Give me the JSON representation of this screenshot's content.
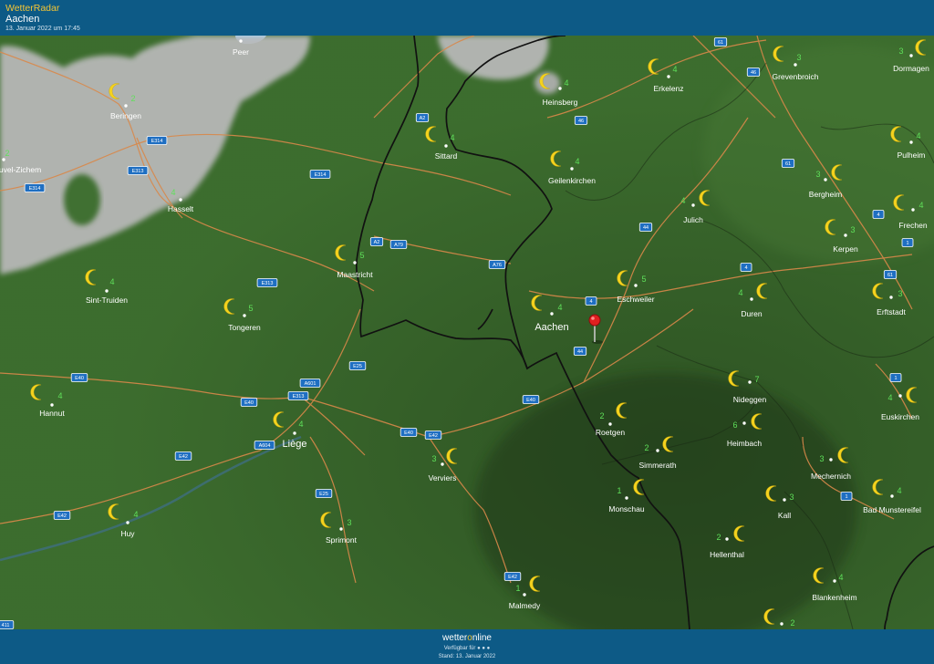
{
  "header": {
    "app_title": "WetterRadar",
    "location": "Aachen",
    "timestamp": "13. Januar 2022 um 17:45"
  },
  "footer": {
    "brand_prefix": "wetter",
    "brand_o": "o",
    "brand_suffix": "nline",
    "available_for": "Verfügbar für",
    "stand": "Stand: 13. Januar 2022"
  },
  "colors": {
    "header_bg": "#0d5a86",
    "app_title": "#f4c534",
    "temperature": "#5fe05a",
    "moon": "#f4d21e",
    "road": "#d9884a",
    "border": "#111111",
    "clouds": "#b9b9b9"
  },
  "map": {
    "pin_icon": "map-pin-icon",
    "weather_icon": "moon-icon",
    "cities": [
      {
        "name": "Peer",
        "temp": ""
      },
      {
        "name": "Beringen",
        "temp": "2"
      },
      {
        "name": "uvel-Zichem",
        "temp": "2"
      },
      {
        "name": "Hasselt",
        "temp": "4"
      },
      {
        "name": "Sint-Truiden",
        "temp": "4"
      },
      {
        "name": "Tongeren",
        "temp": "5"
      },
      {
        "name": "Hannut",
        "temp": "4"
      },
      {
        "name": "Huy",
        "temp": "4"
      },
      {
        "name": "Liège",
        "temp": "4"
      },
      {
        "name": "Sprimont",
        "temp": "3"
      },
      {
        "name": "Verviers",
        "temp": "3"
      },
      {
        "name": "Malmedy",
        "temp": "1"
      },
      {
        "name": "Maastricht",
        "temp": "5"
      },
      {
        "name": "Sittard",
        "temp": "4"
      },
      {
        "name": "Heinsberg",
        "temp": "4"
      },
      {
        "name": "Geilenkirchen",
        "temp": "4"
      },
      {
        "name": "Erkelenz",
        "temp": "4"
      },
      {
        "name": "Grevenbroich",
        "temp": "3"
      },
      {
        "name": "Dormagen",
        "temp": "3"
      },
      {
        "name": "Pulheim",
        "temp": "4"
      },
      {
        "name": "Bergheim",
        "temp": "3"
      },
      {
        "name": "Frechen",
        "temp": "4"
      },
      {
        "name": "Kerpen",
        "temp": "3"
      },
      {
        "name": "Erftstadt",
        "temp": "3"
      },
      {
        "name": "Julich",
        "temp": "4"
      },
      {
        "name": "Eschweiler",
        "temp": "5"
      },
      {
        "name": "Aachen",
        "temp": "4"
      },
      {
        "name": "Duren",
        "temp": "4"
      },
      {
        "name": "Nideggen",
        "temp": "7"
      },
      {
        "name": "Roetgen",
        "temp": "2"
      },
      {
        "name": "Heimbach",
        "temp": "6"
      },
      {
        "name": "Simmerath",
        "temp": "2"
      },
      {
        "name": "Monschau",
        "temp": "1"
      },
      {
        "name": "Euskirchen",
        "temp": "4"
      },
      {
        "name": "Mechernich",
        "temp": "3"
      },
      {
        "name": "Kall",
        "temp": "3"
      },
      {
        "name": "Bad Munstereifel",
        "temp": "4"
      },
      {
        "name": "Hellenthal",
        "temp": "2"
      },
      {
        "name": "Blankenheim",
        "temp": "4"
      },
      {
        "name": "",
        "temp": "2"
      }
    ],
    "road_shields": [
      "61",
      "46",
      "A2",
      "46",
      "E314",
      "E313",
      "E314",
      "E314",
      "61",
      "44",
      "A2",
      "A79",
      "A76",
      "E313",
      "4",
      "4",
      "4",
      "61",
      "1",
      "44",
      "E40",
      "A601",
      "E313",
      "E25",
      "E40",
      "E40",
      "E40",
      "E42",
      "A604",
      "E42",
      "1",
      "E25",
      "E42",
      "E42",
      "1",
      "411"
    ]
  }
}
